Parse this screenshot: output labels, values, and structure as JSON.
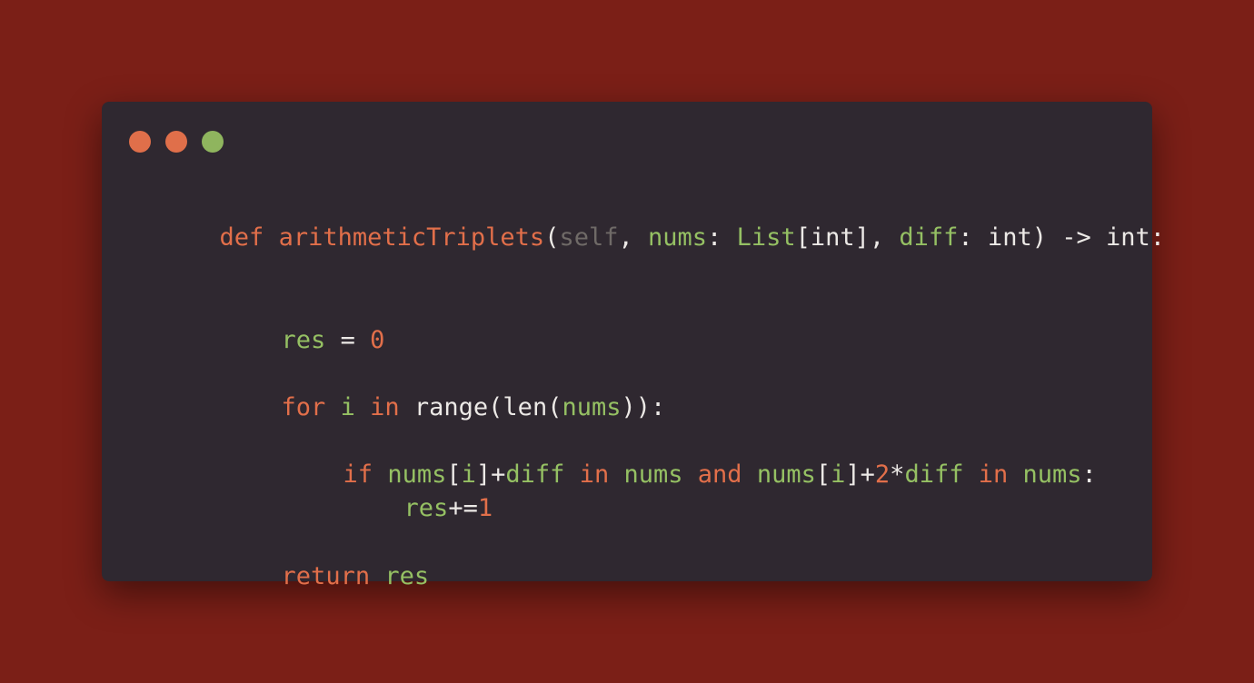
{
  "window": {
    "dots": [
      {
        "name": "close-dot",
        "color": "#e06f4a"
      },
      {
        "name": "minimize-dot",
        "color": "#e06f4a"
      },
      {
        "name": "maximize-dot",
        "color": "#8fb55e"
      }
    ]
  },
  "code": {
    "line1": {
      "def": "def",
      "sp1": " ",
      "fname": "arithmeticTriplets",
      "p1": "(",
      "self": "self",
      "p2": ", ",
      "nums": "nums",
      "p3": ": ",
      "List": "List",
      "p4": "[int], ",
      "diff": "diff",
      "p5": ": int) -> int:"
    },
    "line2": {
      "res": "res",
      "p1": " = ",
      "zero": "0"
    },
    "line3": {
      "for": "for",
      "sp1": " ",
      "i": "i",
      "sp2": " ",
      "in": "in",
      "p1": " range(len(",
      "nums": "nums",
      "p2": ")):"
    },
    "line4": {
      "if": "if",
      "sp1": " ",
      "nums1": "nums",
      "p1": "[",
      "i1": "i",
      "p2": "]+",
      "diff1": "diff",
      "sp2": " ",
      "in1": "in",
      "sp3": " ",
      "nums2": "nums",
      "sp4": " ",
      "and": "and",
      "sp5": " ",
      "nums3": "nums",
      "p3": "[",
      "i2": "i",
      "p4": "]+",
      "two": "2",
      "p5": "*",
      "diff2": "diff",
      "sp6": " ",
      "in2": "in",
      "sp7": " ",
      "nums4": "nums",
      "p6": ":"
    },
    "line5": {
      "res": "res",
      "p1": "+=",
      "one": "1"
    },
    "line6": {
      "return": "return",
      "sp1": " ",
      "res": "res"
    }
  }
}
